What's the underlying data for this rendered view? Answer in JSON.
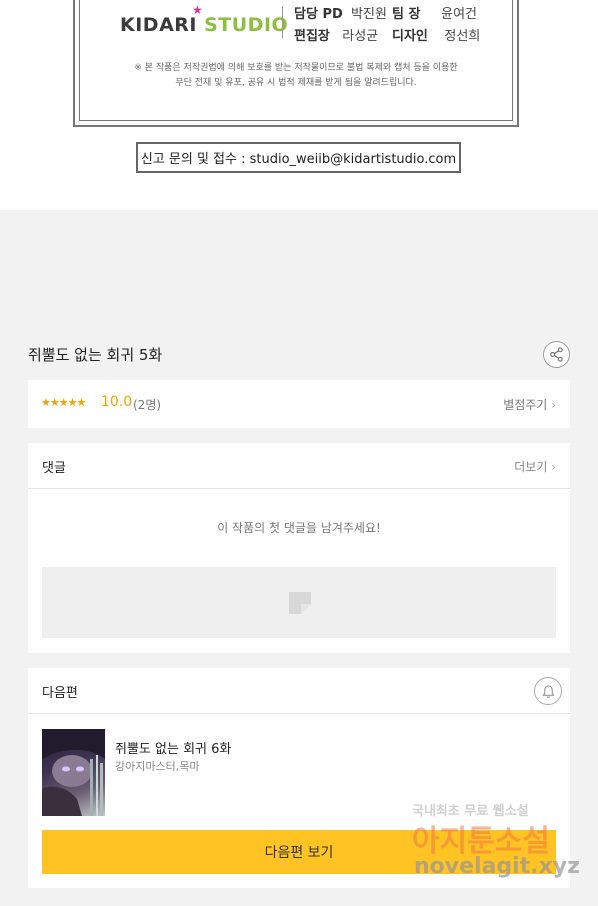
{
  "credits": {
    "logo_text_kid": "KIDARI",
    "logo_text_studio": "STUDIO",
    "staff": [
      {
        "role": "담당 PD",
        "name": "박진원"
      },
      {
        "role": "편집장",
        "name": "라성균"
      },
      {
        "role": "팀  장",
        "name": "윤여건"
      },
      {
        "role": "디자인",
        "name": "정선희"
      }
    ],
    "notice_line1": "※ 본 작품은 저작권법에 의해 보호를 받는 저작물이므로 불법 복제와 캡처 등을 이용한",
    "notice_line2": "무단 전재 및 유포, 공유 시 법적 제재를 받게 됨을 알려드립니다.",
    "report": "신고 문의 및 접수 : studio_weiib@kidartistudio.com"
  },
  "episode": {
    "title": "쥐뿔도 없는 회귀 5화"
  },
  "rating": {
    "stars": "★★★★★",
    "score": "10.0",
    "count": "(2명)",
    "rate_link": "별점주기"
  },
  "comments": {
    "header": "댓글",
    "more_link": "더보기",
    "empty_message": "이 작품의 첫 댓글을 남겨주세요!"
  },
  "next_episode": {
    "header": "다음편",
    "title": "쥐뿔도 없는 회귀 6화",
    "author": "강아지마스터,목마",
    "button_label": "다음편 보기"
  },
  "watermark": {
    "line1": "국내최초 무료 웹소설",
    "line2": "아지툰소설",
    "line3": "novelagit.xyz"
  },
  "colors": {
    "accent_yellow": "#ffc424",
    "star_orange": "#f3a200",
    "logo_green": "#8cbf3f",
    "logo_pink": "#e0338f"
  },
  "icons": {
    "share": "share-icon",
    "bell": "bell-icon",
    "chevron": "chevron-right-icon",
    "input_placeholder": "image-placeholder-icon"
  }
}
